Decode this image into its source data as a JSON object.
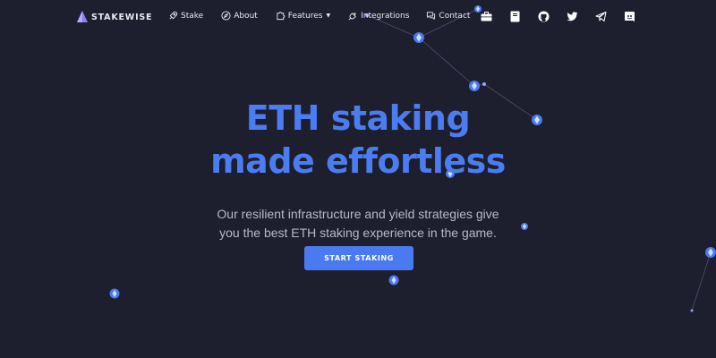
{
  "brand": {
    "name": "STAKEWISE"
  },
  "nav": {
    "stake": "Stake",
    "about": "About",
    "features": "Features",
    "integrations": "Integrations",
    "contact": "Contact"
  },
  "social_icons": [
    "briefcase-icon",
    "book-icon",
    "github-icon",
    "twitter-icon",
    "telegram-icon",
    "discord-icon"
  ],
  "hero": {
    "title_line1": "ETH staking",
    "title_line2": "made effortless",
    "subtitle_line1": "Our resilient infrastructure and yield strategies give",
    "subtitle_line2": "you the best ETH staking experience in the game.",
    "cta_label": "START STAKING"
  },
  "colors": {
    "background": "#1d1e2e",
    "accent": "#4b7cf0",
    "button": "#4a7af0",
    "text_muted": "#b9bac8"
  }
}
